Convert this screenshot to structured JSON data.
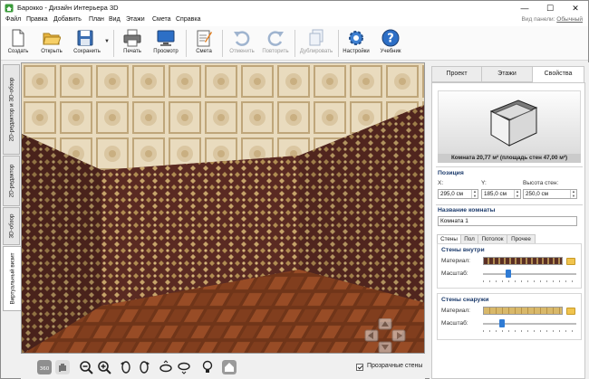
{
  "window": {
    "title": "Барокко - Дизайн Интерьера 3D",
    "minimize_glyph": "—",
    "maximize_glyph": "☐",
    "close_glyph": "✕"
  },
  "menu": {
    "items": [
      "Файл",
      "Правка",
      "Добавить",
      "План",
      "Вид",
      "Этажи",
      "Смета",
      "Справка"
    ],
    "panel_view_label": "Вид панели:",
    "panel_view_value": "Обычный"
  },
  "toolbar": {
    "buttons": [
      {
        "label": "Создать",
        "icon": "new-file-icon",
        "enabled": true
      },
      {
        "label": "Открыть",
        "icon": "folder-open-icon",
        "enabled": true
      },
      {
        "label": "Сохранить",
        "icon": "floppy-disk-icon",
        "enabled": true
      },
      {
        "label": "Печать",
        "icon": "printer-icon",
        "enabled": true
      },
      {
        "label": "Просмотр",
        "icon": "monitor-icon",
        "enabled": true
      },
      {
        "label": "Смета",
        "icon": "estimate-clipboard-icon",
        "enabled": true
      },
      {
        "label": "Отменить",
        "icon": "undo-icon",
        "enabled": false
      },
      {
        "label": "Повторить",
        "icon": "redo-icon",
        "enabled": false
      },
      {
        "label": "Дублировать",
        "icon": "duplicate-icon",
        "enabled": false
      },
      {
        "label": "Настройки",
        "icon": "gear-icon",
        "enabled": true
      },
      {
        "label": "Учебник",
        "icon": "help-icon",
        "enabled": true
      }
    ]
  },
  "left_tabs": [
    {
      "label": "2D-редактор и 3D-обзор",
      "active": false
    },
    {
      "label": "2D-редактор",
      "active": false
    },
    {
      "label": "3D-обзор",
      "active": false
    },
    {
      "label": "Виртуальный визит",
      "active": true
    }
  ],
  "bottom_bar": {
    "transparent_walls_label": "Прозрачные стены",
    "transparent_walls_checked": true,
    "tools": [
      "rotate-360-icon",
      "hand-icon",
      "zoom-out-icon",
      "zoom-in-icon",
      "rotate-left-icon",
      "rotate-right-icon",
      "tilt-up-icon",
      "tilt-down-icon",
      "lightbulb-icon",
      "home-icon"
    ]
  },
  "right_panel": {
    "tabs": [
      {
        "label": "Проект",
        "active": false
      },
      {
        "label": "Этажи",
        "active": false
      },
      {
        "label": "Свойства",
        "active": true
      }
    ],
    "room_caption": "Комната 20,77 м² (площадь стен 47,00 м²)",
    "position_title": "Позиция",
    "x_label": "X:",
    "x_value": "295,0 см",
    "y_label": "Y:",
    "y_value": "185,0 см",
    "height_label": "Высота стен:",
    "height_value": "250,0 см",
    "name_title": "Название комнаты",
    "name_value": "Комната 1",
    "sub_tabs": [
      {
        "label": "Стены",
        "active": true
      },
      {
        "label": "Пол",
        "active": false
      },
      {
        "label": "Потолок",
        "active": false
      },
      {
        "label": "Прочее",
        "active": false
      }
    ],
    "inner_walls_title": "Стены внутри",
    "outer_walls_title": "Стены снаружи",
    "material_label": "Материал:",
    "scale_label": "Масштаб:",
    "inner_scale_fraction": 0.27,
    "outer_scale_fraction": 0.2,
    "inner_swatch_color": "#5a2e24",
    "outer_swatch_color": "#d8b86a"
  }
}
